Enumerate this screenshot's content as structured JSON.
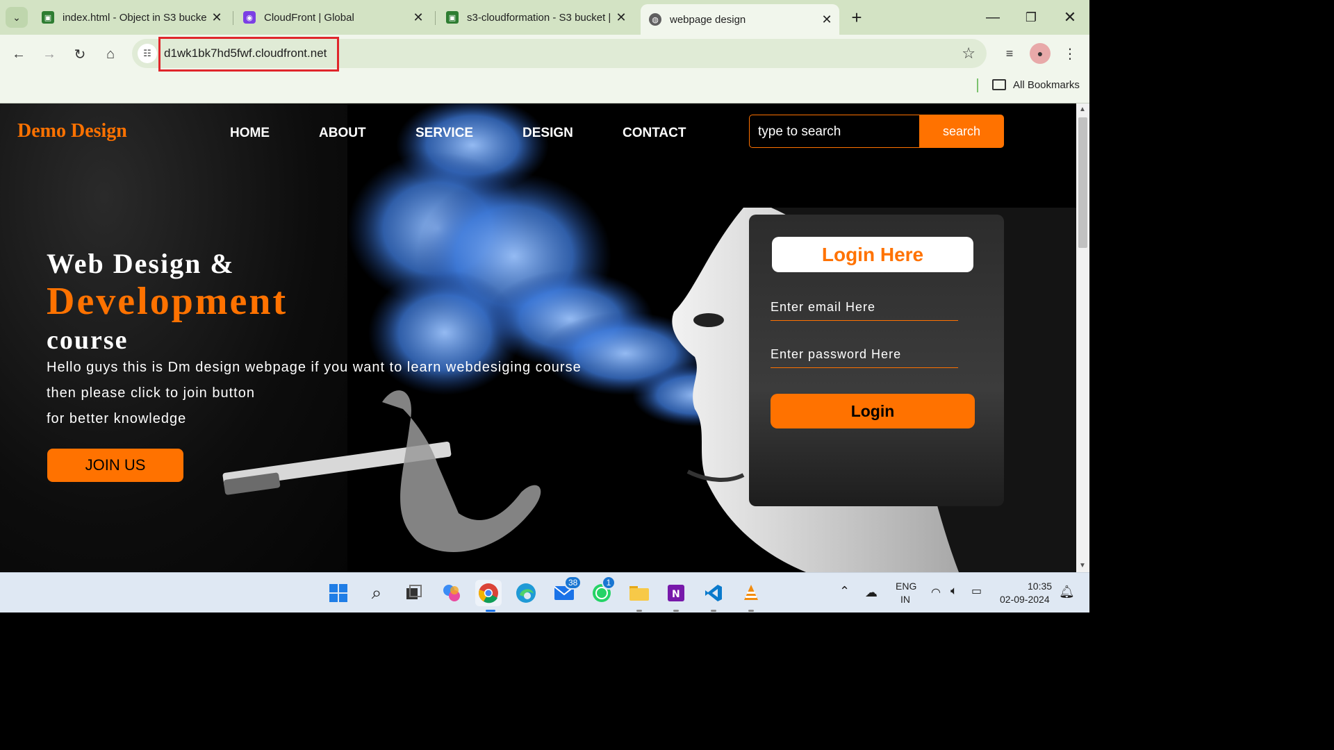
{
  "browser": {
    "tabs": [
      {
        "title": "index.html - Object in S3 bucke",
        "icon": "s3-icon",
        "color": "#2e7d32"
      },
      {
        "title": "CloudFront | Global",
        "icon": "cloudfront-icon",
        "color": "#7b3fe4"
      },
      {
        "title": "s3-cloudformation - S3 bucket |",
        "icon": "s3-icon",
        "color": "#2e7d32"
      },
      {
        "title": "webpage design",
        "icon": "globe-icon",
        "color": "#444444"
      }
    ],
    "close_glyph": "✕",
    "new_tab_glyph": "+",
    "url": "d1wk1bk7hd5fwf.cloudfront.net",
    "bookmarks_label": "All Bookmarks"
  },
  "page": {
    "logo": "Demo Design",
    "menu": [
      "HOME",
      "ABOUT",
      "SERVICE",
      "DESIGN",
      "CONTACT"
    ],
    "search_placeholder": "type to search",
    "search_button": "search",
    "hero_line1": "Web Design &",
    "hero_line2": "Development",
    "hero_line3": "course",
    "paragraph": [
      "Hello guys this is Dm design webpage if you want to learn webdesiging course",
      "then please click to join button",
      "for better knowledge"
    ],
    "join_button": "JOIN US",
    "login": {
      "title": "Login Here",
      "email_placeholder": "Enter email Here",
      "password_placeholder": "Enter password Here",
      "button": "Login"
    },
    "accent_color": "#ff7200"
  },
  "taskbar": {
    "mail_badge": "38",
    "whatsapp_badge": "1",
    "language": "ENG",
    "region": "IN",
    "time": "10:35",
    "date": "02-09-2024"
  }
}
